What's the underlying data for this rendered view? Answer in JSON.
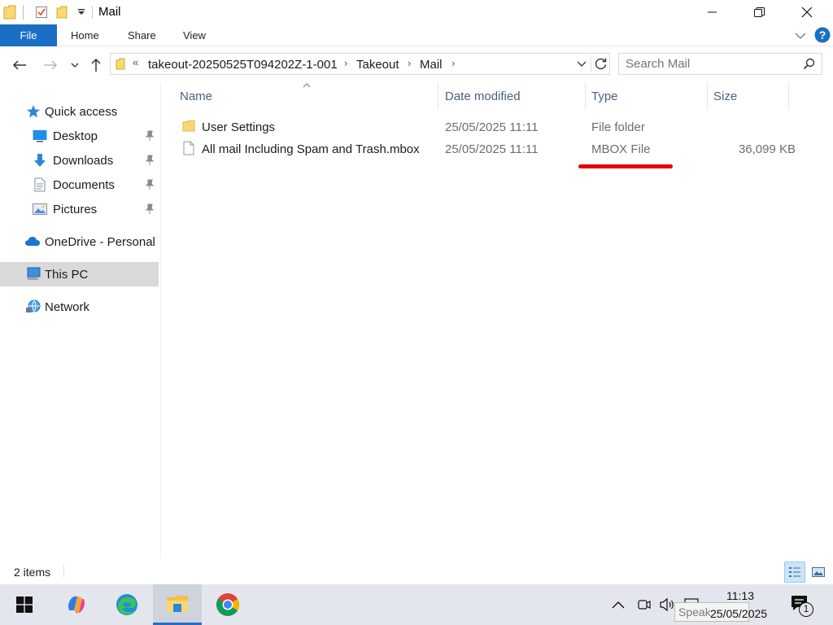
{
  "window": {
    "title": "Mail"
  },
  "ribbon": {
    "tabs": [
      {
        "label": "File"
      },
      {
        "label": "Home"
      },
      {
        "label": "Share"
      },
      {
        "label": "View"
      }
    ]
  },
  "address": {
    "overflow": "«",
    "crumbs": [
      "takeout-20250525T094202Z-1-001",
      "Takeout",
      "Mail"
    ],
    "separator": "›"
  },
  "search": {
    "placeholder": "Search Mail"
  },
  "sidebar": {
    "items": [
      {
        "label": "Quick access",
        "icon": "star-icon"
      },
      {
        "label": "Desktop",
        "icon": "desktop-icon",
        "pinned": true
      },
      {
        "label": "Downloads",
        "icon": "download-icon",
        "pinned": true
      },
      {
        "label": "Documents",
        "icon": "documents-icon",
        "pinned": true
      },
      {
        "label": "Pictures",
        "icon": "pictures-icon",
        "pinned": true
      },
      {
        "label": "OneDrive - Personal",
        "icon": "cloud-icon"
      },
      {
        "label": "This PC",
        "icon": "computer-icon",
        "selected": true
      },
      {
        "label": "Network",
        "icon": "network-icon"
      }
    ]
  },
  "columns": {
    "name": "Name",
    "date": "Date modified",
    "type": "Type",
    "size": "Size"
  },
  "files": [
    {
      "name": "User Settings",
      "date": "25/05/2025 11:11",
      "type": "File folder",
      "size": "",
      "icon": "folder-icon"
    },
    {
      "name": "All mail Including Spam and Trash.mbox",
      "date": "25/05/2025 11:11",
      "type": "MBOX File",
      "size": "36,099 KB",
      "icon": "file-icon"
    }
  ],
  "status": {
    "item_count": "2 items"
  },
  "taskbar": {
    "time": "11:13",
    "date": "25/05/2025",
    "tooltip": "Speak",
    "notification_count": "1"
  },
  "colors": {
    "accent": "#1a6fc4",
    "annotation": "#e60000"
  }
}
